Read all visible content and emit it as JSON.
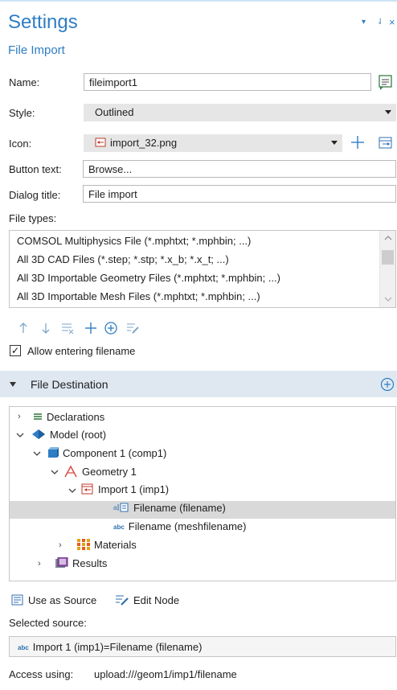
{
  "window": {
    "title": "Settings",
    "subtitle": "File Import",
    "controls": [
      "▾",
      "⇃",
      "×"
    ]
  },
  "form": {
    "name_label": "Name:",
    "name_value": "fileimport1",
    "style_label": "Style:",
    "style_value": "Outlined",
    "icon_label": "Icon:",
    "icon_value": "import_32.png",
    "button_text_label": "Button text:",
    "button_text_value": "Browse...",
    "dialog_title_label": "Dialog title:",
    "dialog_title_value": "File import",
    "file_types_label": "File types:"
  },
  "file_types": [
    "COMSOL Multiphysics File (*.mphtxt; *.mphbin; ...)",
    "All 3D CAD Files (*.step; *.stp; *.x_b; *.x_t; ...)",
    "All 3D Importable Geometry Files (*.mphtxt; *.mphbin; ...)",
    "All 3D Importable Mesh Files (*.mphtxt; *.mphbin; ...)"
  ],
  "allow_filename": {
    "label": "Allow entering filename",
    "checked": true
  },
  "section": {
    "title": "File Destination"
  },
  "tree": [
    {
      "label": "Declarations"
    },
    {
      "label": "Model (root)"
    },
    {
      "label": "Component 1 (comp1)"
    },
    {
      "label": "Geometry 1"
    },
    {
      "label": "Import 1 (imp1)"
    },
    {
      "label": "Filename (filename)"
    },
    {
      "label": "Filename (meshfilename)"
    },
    {
      "label": "Materials"
    },
    {
      "label": "Results"
    }
  ],
  "actions": {
    "use_as_source": "Use as Source",
    "edit_node": "Edit Node"
  },
  "selected_source": {
    "label": "Selected source:",
    "value": "Import 1 (imp1)=Filename (filename)",
    "badge": "abc"
  },
  "access": {
    "label": "Access using:",
    "value": "upload:///geom1/imp1/filename"
  },
  "colors": {
    "accent": "#2f7dc4",
    "section_bg": "#dfe8f1",
    "selection_bg": "#d9d9d9"
  }
}
